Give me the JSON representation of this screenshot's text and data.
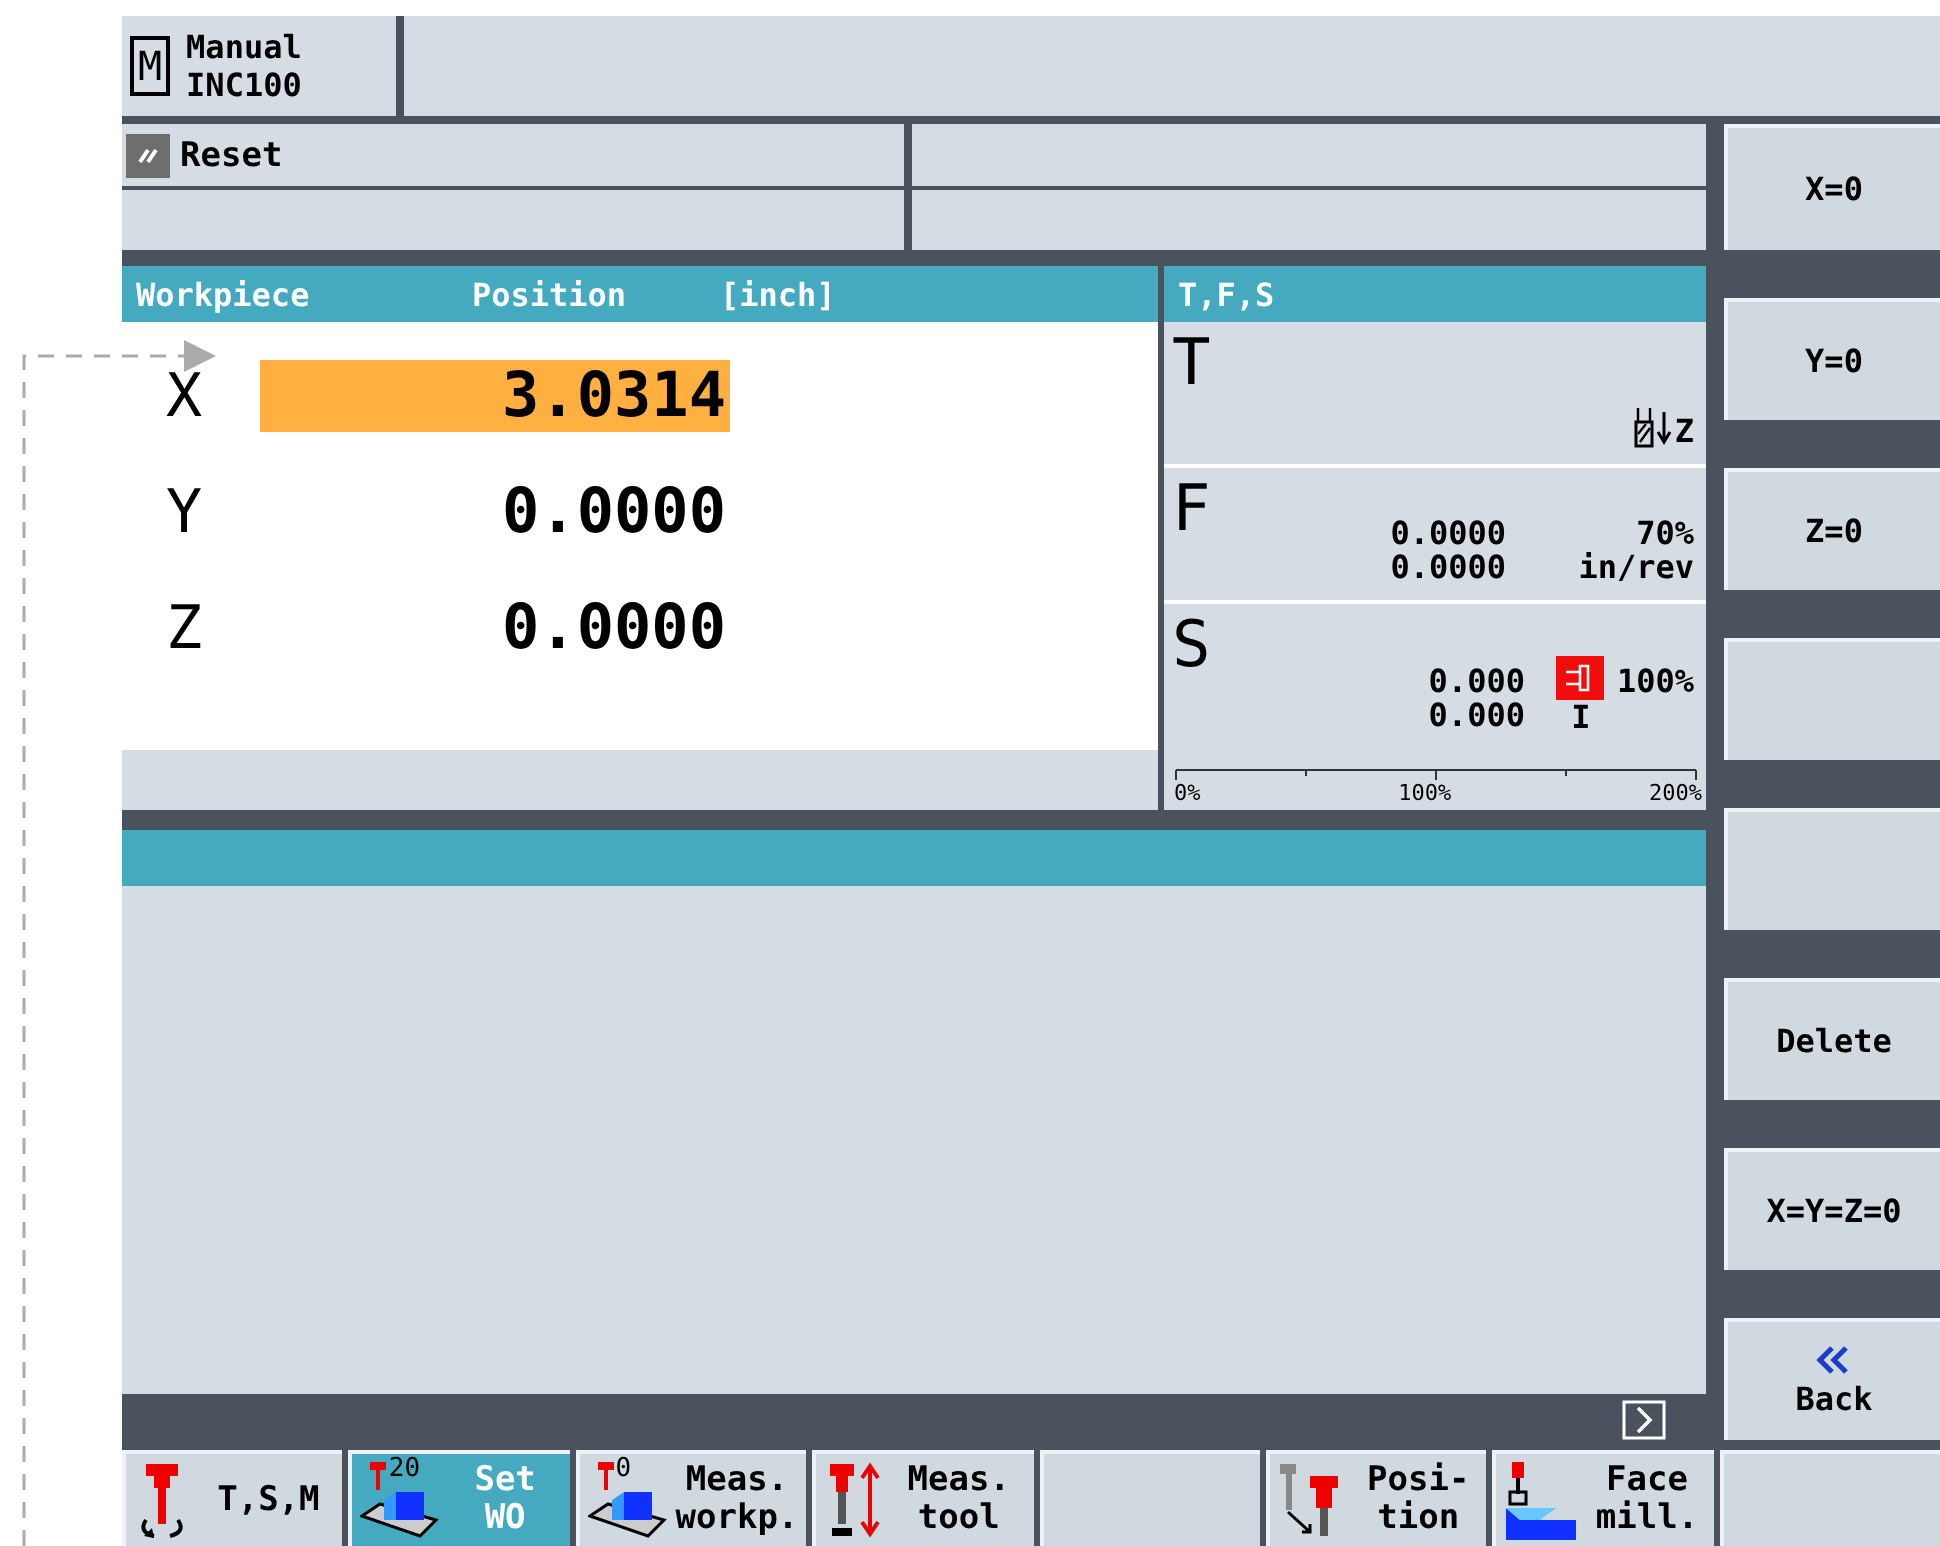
{
  "mode": {
    "symbol": "M",
    "lines": [
      "Manual",
      "INC100"
    ]
  },
  "channel_status": {
    "label": "Reset"
  },
  "position_table": {
    "columns": [
      "Workpiece",
      "Position",
      "[inch]"
    ],
    "rows": [
      {
        "axis": "X",
        "value": "3.0314",
        "selected": true
      },
      {
        "axis": "Y",
        "value": "0.0000",
        "selected": false
      },
      {
        "axis": "Z",
        "value": "0.0000",
        "selected": false
      }
    ]
  },
  "tfs": {
    "title": "T,F,S",
    "tool": {
      "letter": "T",
      "axis": "Z"
    },
    "feed": {
      "letter": "F",
      "values": [
        "0.0000",
        "0.0000"
      ],
      "override": "70%",
      "unit": "in/rev"
    },
    "spindle": {
      "letter": "S",
      "values": [
        "0.000",
        "0.000"
      ],
      "override": "100%",
      "gear": "I"
    },
    "scale_labels": [
      "0%",
      "100%",
      "200%"
    ]
  },
  "vertical_softkeys": [
    {
      "kind": "text",
      "label": "X=0"
    },
    {
      "kind": "text",
      "label": "Y=0"
    },
    {
      "kind": "text",
      "label": "Z=0"
    },
    {
      "kind": "blank"
    },
    {
      "kind": "blank"
    },
    {
      "kind": "text",
      "label": "Delete"
    },
    {
      "kind": "text",
      "label": "X=Y=Z=0"
    },
    {
      "kind": "back",
      "label": "Back"
    }
  ],
  "horizontal_softkeys": [
    {
      "kind": "spindle",
      "lines": [
        "T,S,M"
      ],
      "selected": false
    },
    {
      "kind": "set_wo",
      "icon_text": "20",
      "lines": [
        "Set",
        "WO"
      ],
      "selected": true
    },
    {
      "kind": "meas_workp",
      "icon_text": "0",
      "lines": [
        "Meas.",
        "workp."
      ],
      "selected": false
    },
    {
      "kind": "meas_tool",
      "lines": [
        "Meas.",
        "tool"
      ],
      "selected": false
    },
    {
      "kind": "blank",
      "selected": false
    },
    {
      "kind": "position",
      "lines": [
        "Posi-",
        "tion"
      ],
      "selected": false
    },
    {
      "kind": "face_mill",
      "lines": [
        "Face",
        "mill."
      ],
      "selected": false
    },
    {
      "kind": "blank",
      "selected": false
    }
  ]
}
